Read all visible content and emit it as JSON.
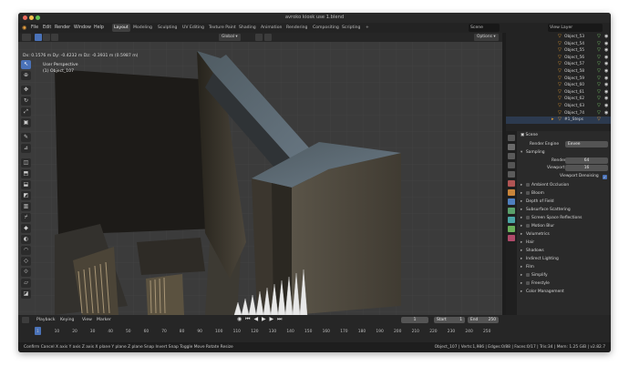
{
  "window": {
    "title": "avroko kiosk use 1.blend"
  },
  "menu": [
    "File",
    "Edit",
    "Render",
    "Window",
    "Help"
  ],
  "workspaces": [
    "Layout",
    "Modeling",
    "Sculpting",
    "UV Editing",
    "Texture Paint",
    "Shading",
    "Animation",
    "Rendering",
    "Compositing",
    "Scripting",
    "+"
  ],
  "scene": {
    "label": "Scene",
    "view_layer": "View Layer"
  },
  "viewport": {
    "transform_orient": "Global",
    "options": "Options",
    "view_name": "User Perspective",
    "object_name": "(1) Object_107",
    "measure": "Dx: 0.1576 m   Dy: -0.4232 m   Dz: -0.3931 m (0.5987 m)"
  },
  "toolbar_icons": [
    "select-icon",
    "cursor-icon",
    "move-icon",
    "rotate-icon",
    "scale-icon",
    "transform-icon",
    "annotate-icon",
    "measure-icon",
    "add-cube-icon",
    "extrude-icon",
    "inset-icon",
    "bevel-icon",
    "loop-cut-icon",
    "knife-icon",
    "poly-build-icon",
    "spin-icon",
    "smooth-icon",
    "edge-slide-icon",
    "shrink-icon",
    "shear-icon",
    "rip-icon"
  ],
  "outliner": {
    "items": [
      "Object_53",
      "Object_54",
      "Object_55",
      "Object_56",
      "Object_57",
      "Object_58",
      "Object_59",
      "Object_60",
      "Object_61",
      "Object_62",
      "Object_63",
      "Object_74",
      "#1_Steps"
    ]
  },
  "properties": {
    "scene_label": "Scene",
    "render_engine_label": "Render Engine",
    "render_engine": "Eevee",
    "sampling": "Sampling",
    "render_label": "Render",
    "render_value": "64",
    "viewport_label": "Viewport",
    "viewport_value": "16",
    "viewport_denoising": "Viewport Denoising",
    "panels": [
      "Ambient Occlusion",
      "Bloom",
      "Depth of Field",
      "Subsurface Scattering",
      "Screen Space Reflections",
      "Motion Blur",
      "Volumetrics",
      "Hair",
      "Shadows",
      "Indirect Lighting",
      "Film",
      "Simplify",
      "Freestyle",
      "Color Management"
    ]
  },
  "timeline": {
    "menus": [
      "Playback",
      "Keying",
      "View",
      "Marker"
    ],
    "current_frame": "1",
    "start_label": "Start",
    "start": "1",
    "end_label": "End",
    "end": "250",
    "ticks": [
      "1",
      "10",
      "20",
      "30",
      "40",
      "50",
      "60",
      "70",
      "80",
      "90",
      "100",
      "110",
      "120",
      "130",
      "140",
      "150",
      "160",
      "170",
      "180",
      "190",
      "200",
      "210",
      "220",
      "230",
      "240",
      "250"
    ]
  },
  "statusbar": {
    "left": "Confirm   Cancel   X axis   Y axis   Z axis   X plane   Y plane   Z plane   Snap Invert   Snap Toggle   Move   Rotate   Resize",
    "right": "Object_107 | Verts:1,986 | Edges:0/88 | Faces:0/17 | Tris:34 | Mem: 1.25 GiB | v2.82.7"
  }
}
